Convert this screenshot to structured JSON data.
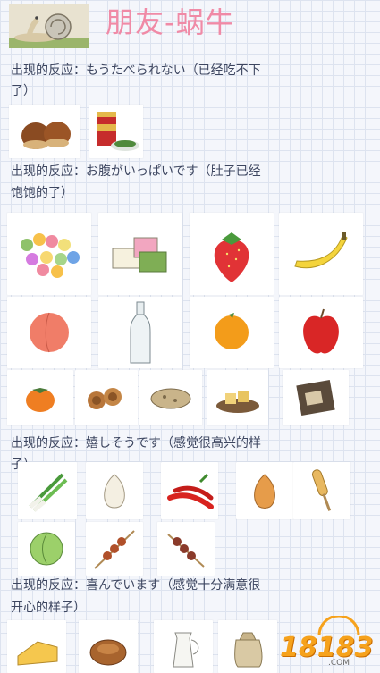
{
  "page_title": "朋友-蜗牛",
  "sections": [
    {
      "reaction_line1": "出现的反应：もうたべられない（已经吃不下",
      "reaction_line2": "了）"
    },
    {
      "reaction_line1": "出现的反应：お腹がいっぱいです（肚子已经",
      "reaction_line2": "饱饱的了）"
    },
    {
      "reaction_line1": "出现的反应：嬉しそうです（感觉很高兴的样",
      "reaction_line2": "子）"
    },
    {
      "reaction_line1": "出现的反应：喜んでいます（感觉十分满意很",
      "reaction_line2": "开心的样子）"
    }
  ],
  "watermark": {
    "number": "18183",
    "domain": ".COM"
  },
  "icons": [
    "snail-icon",
    "chestnut-icon",
    "canned-food-icon",
    "dango-icon",
    "mochi-icon",
    "strawberry-icon",
    "banana-icon",
    "peach-icon",
    "bottle-icon",
    "orange-icon",
    "apple-icon",
    "persimmon-icon",
    "cookies-icon",
    "biscuit-icon",
    "tofu-icon",
    "seaweed-icon",
    "green-onion-icon",
    "garlic-icon",
    "chili-icon",
    "onion-icon",
    "corn-dog-icon",
    "cabbage-icon",
    "skewer-icon",
    "meatball-skewer-icon",
    "cheese-icon",
    "bread-icon",
    "milk-icon",
    "flour-sack-icon"
  ]
}
